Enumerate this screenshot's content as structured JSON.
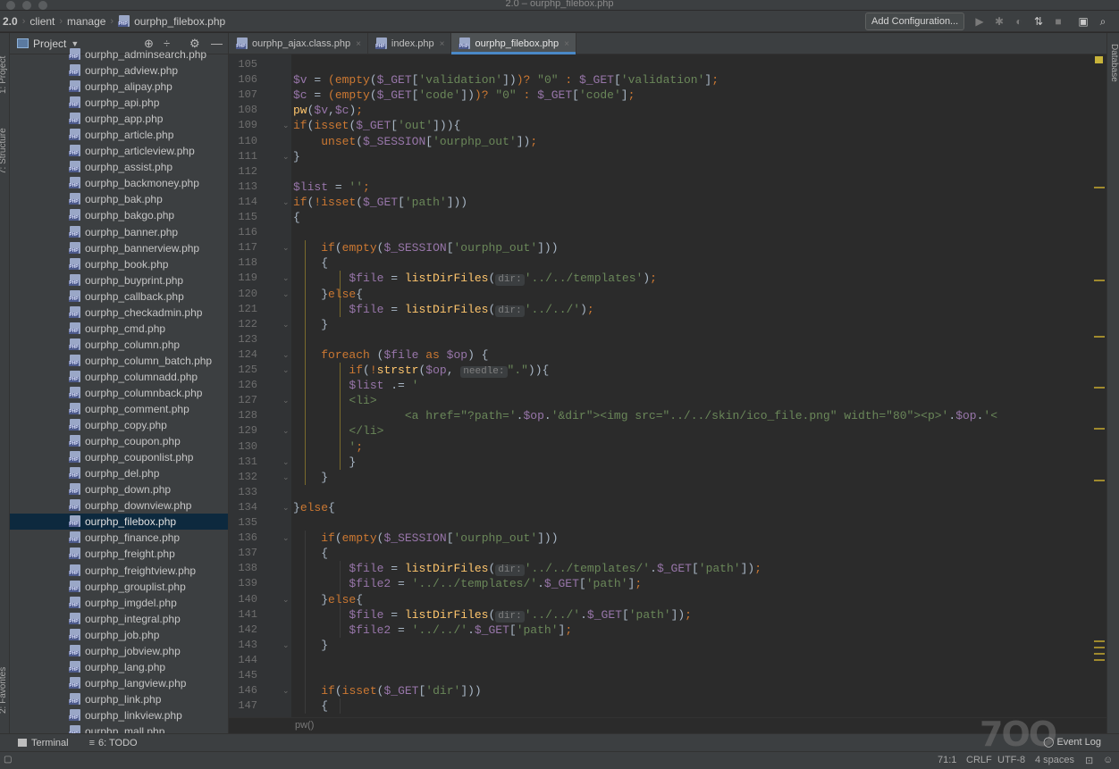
{
  "window": {
    "title": "2.0 – ourphp_filebox.php"
  },
  "breadcrumbs": [
    "2.0",
    "client",
    "manage",
    "ourphp_filebox.php"
  ],
  "toolbar": {
    "add_configuration": "Add Configuration..."
  },
  "left_tool_labels": [
    "1: Project",
    "7: Structure",
    "2: Favorites"
  ],
  "right_tool_labels": [
    "Database"
  ],
  "project": {
    "title": "Project",
    "files": [
      "ourphp_adminsearch.php",
      "ourphp_adview.php",
      "ourphp_alipay.php",
      "ourphp_api.php",
      "ourphp_app.php",
      "ourphp_article.php",
      "ourphp_articleview.php",
      "ourphp_assist.php",
      "ourphp_backmoney.php",
      "ourphp_bak.php",
      "ourphp_bakgo.php",
      "ourphp_banner.php",
      "ourphp_bannerview.php",
      "ourphp_book.php",
      "ourphp_buyprint.php",
      "ourphp_callback.php",
      "ourphp_checkadmin.php",
      "ourphp_cmd.php",
      "ourphp_column.php",
      "ourphp_column_batch.php",
      "ourphp_columnadd.php",
      "ourphp_columnback.php",
      "ourphp_comment.php",
      "ourphp_copy.php",
      "ourphp_coupon.php",
      "ourphp_couponlist.php",
      "ourphp_del.php",
      "ourphp_down.php",
      "ourphp_downview.php",
      "ourphp_filebox.php",
      "ourphp_finance.php",
      "ourphp_freight.php",
      "ourphp_freightview.php",
      "ourphp_grouplist.php",
      "ourphp_imgdel.php",
      "ourphp_integral.php",
      "ourphp_job.php",
      "ourphp_jobview.php",
      "ourphp_lang.php",
      "ourphp_langview.php",
      "ourphp_link.php",
      "ourphp_linkview.php",
      "ourphp_mall.php"
    ],
    "selected_file": "ourphp_filebox.php"
  },
  "tabs": [
    {
      "label": "ourphp_ajax.class.php",
      "active": false
    },
    {
      "label": "index.php",
      "active": false
    },
    {
      "label": "ourphp_filebox.php",
      "active": true
    }
  ],
  "editor": {
    "first_line": 105,
    "breadcrumb_hint": "pw()",
    "lines": [
      [],
      [
        [
          "var",
          "$v"
        ],
        [
          "plain",
          " = "
        ],
        [
          "kw",
          "("
        ],
        [
          "kw",
          "empty"
        ],
        [
          "plain",
          "("
        ],
        [
          "var",
          "$_GET"
        ],
        [
          "plain",
          "["
        ],
        [
          "str",
          "'validation'"
        ],
        [
          "plain",
          "])"
        ],
        [
          "kw",
          ")"
        ],
        [
          "kw",
          "? "
        ],
        [
          "str",
          "\"0\""
        ],
        [
          "kw",
          " : "
        ],
        [
          "var",
          "$_GET"
        ],
        [
          "plain",
          "["
        ],
        [
          "str",
          "'validation'"
        ],
        [
          "plain",
          "]"
        ],
        [
          "kw",
          ";"
        ]
      ],
      [
        [
          "var",
          "$c"
        ],
        [
          "plain",
          " = "
        ],
        [
          "kw",
          "("
        ],
        [
          "kw",
          "empty"
        ],
        [
          "plain",
          "("
        ],
        [
          "var",
          "$_GET"
        ],
        [
          "plain",
          "["
        ],
        [
          "str",
          "'code'"
        ],
        [
          "plain",
          "])"
        ],
        [
          "kw",
          ")"
        ],
        [
          "kw",
          "? "
        ],
        [
          "str",
          "\"0\""
        ],
        [
          "kw",
          " : "
        ],
        [
          "var",
          "$_GET"
        ],
        [
          "plain",
          "["
        ],
        [
          "str",
          "'code'"
        ],
        [
          "plain",
          "]"
        ],
        [
          "kw",
          ";"
        ]
      ],
      [
        [
          "fn",
          "pw"
        ],
        [
          "plain",
          "("
        ],
        [
          "var",
          "$v"
        ],
        [
          "plain",
          ","
        ],
        [
          "var",
          "$c"
        ],
        [
          "plain",
          ")"
        ],
        [
          "kw",
          ";"
        ]
      ],
      [
        [
          "kw",
          "if"
        ],
        [
          "plain",
          "("
        ],
        [
          "kw",
          "isset"
        ],
        [
          "plain",
          "("
        ],
        [
          "var",
          "$_GET"
        ],
        [
          "plain",
          "["
        ],
        [
          "str",
          "'out'"
        ],
        [
          "plain",
          "])){"
        ]
      ],
      [
        [
          "plain",
          "    "
        ],
        [
          "kw",
          "unset"
        ],
        [
          "plain",
          "("
        ],
        [
          "var",
          "$_SESSION"
        ],
        [
          "plain",
          "["
        ],
        [
          "str",
          "'ourphp_out'"
        ],
        [
          "plain",
          "])"
        ],
        [
          "kw",
          ";"
        ]
      ],
      [
        [
          "plain",
          "}"
        ]
      ],
      [],
      [
        [
          "var",
          "$list"
        ],
        [
          "plain",
          " = "
        ],
        [
          "str",
          "''"
        ],
        [
          "kw",
          ";"
        ]
      ],
      [
        [
          "kw",
          "if"
        ],
        [
          "plain",
          "("
        ],
        [
          "kw",
          "!isset"
        ],
        [
          "plain",
          "("
        ],
        [
          "var",
          "$_GET"
        ],
        [
          "plain",
          "["
        ],
        [
          "str",
          "'path'"
        ],
        [
          "plain",
          "]))"
        ]
      ],
      [
        [
          "plain",
          "{"
        ]
      ],
      [],
      [
        [
          "plain",
          "    "
        ],
        [
          "kw",
          "if"
        ],
        [
          "plain",
          "("
        ],
        [
          "kw",
          "empty"
        ],
        [
          "plain",
          "("
        ],
        [
          "var",
          "$_SESSION"
        ],
        [
          "plain",
          "["
        ],
        [
          "str",
          "'ourphp_out'"
        ],
        [
          "plain",
          "]))"
        ]
      ],
      [
        [
          "plain",
          "    {"
        ]
      ],
      [
        [
          "plain",
          "        "
        ],
        [
          "var",
          "$file"
        ],
        [
          "plain",
          " = "
        ],
        [
          "fn",
          "listDirFiles"
        ],
        [
          "plain",
          "("
        ],
        [
          "hint",
          "dir:"
        ],
        [
          "str",
          "'../../templates'"
        ],
        [
          "plain",
          ")"
        ],
        [
          "kw",
          ";"
        ]
      ],
      [
        [
          "plain",
          "    }"
        ],
        [
          "kw",
          "else"
        ],
        [
          "plain",
          "{"
        ]
      ],
      [
        [
          "plain",
          "        "
        ],
        [
          "var",
          "$file"
        ],
        [
          "plain",
          " = "
        ],
        [
          "fn",
          "listDirFiles"
        ],
        [
          "plain",
          "("
        ],
        [
          "hint",
          "dir:"
        ],
        [
          "str",
          "'../../'"
        ],
        [
          "plain",
          ")"
        ],
        [
          "kw",
          ";"
        ]
      ],
      [
        [
          "plain",
          "    }"
        ]
      ],
      [],
      [
        [
          "plain",
          "    "
        ],
        [
          "kw",
          "foreach"
        ],
        [
          "plain",
          " ("
        ],
        [
          "var",
          "$file"
        ],
        [
          "kw",
          " as "
        ],
        [
          "var",
          "$op"
        ],
        [
          "plain",
          ") {"
        ]
      ],
      [
        [
          "plain",
          "        "
        ],
        [
          "kw",
          "if"
        ],
        [
          "plain",
          "("
        ],
        [
          "kw",
          "!"
        ],
        [
          "fn",
          "strstr"
        ],
        [
          "plain",
          "("
        ],
        [
          "var",
          "$op"
        ],
        [
          "plain",
          ", "
        ],
        [
          "hint",
          "needle:"
        ],
        [
          "str",
          "\".\""
        ],
        [
          "plain",
          "))"
        ],
        [
          "plain",
          "{"
        ]
      ],
      [
        [
          "plain",
          "        "
        ],
        [
          "var",
          "$list"
        ],
        [
          "plain",
          " .= "
        ],
        [
          "str",
          "'"
        ]
      ],
      [
        [
          "plain",
          "        "
        ],
        [
          "str",
          "<li>"
        ]
      ],
      [
        [
          "plain",
          "                "
        ],
        [
          "str",
          "<a href=\"?path='"
        ],
        [
          "plain",
          "."
        ],
        [
          "var",
          "$op"
        ],
        [
          "plain",
          "."
        ],
        [
          "str",
          "'&dir\"><img src=\"../../skin/ico_file.png\" width=\"80\"><p>'"
        ],
        [
          "plain",
          "."
        ],
        [
          "var",
          "$op"
        ],
        [
          "plain",
          "."
        ],
        [
          "str",
          "'<"
        ]
      ],
      [
        [
          "plain",
          "        "
        ],
        [
          "str",
          "</li>"
        ]
      ],
      [
        [
          "plain",
          "        "
        ],
        [
          "str",
          "'"
        ],
        [
          "kw",
          ";"
        ]
      ],
      [
        [
          "plain",
          "        }"
        ]
      ],
      [
        [
          "plain",
          "    }"
        ]
      ],
      [],
      [
        [
          "plain",
          "}"
        ],
        [
          "kw",
          "else"
        ],
        [
          "plain",
          "{"
        ]
      ],
      [],
      [
        [
          "plain",
          "    "
        ],
        [
          "kw",
          "if"
        ],
        [
          "plain",
          "("
        ],
        [
          "kw",
          "empty"
        ],
        [
          "plain",
          "("
        ],
        [
          "var",
          "$_SESSION"
        ],
        [
          "plain",
          "["
        ],
        [
          "str",
          "'ourphp_out'"
        ],
        [
          "plain",
          "]))"
        ]
      ],
      [
        [
          "plain",
          "    {"
        ]
      ],
      [
        [
          "plain",
          "        "
        ],
        [
          "var",
          "$file"
        ],
        [
          "plain",
          " = "
        ],
        [
          "fn",
          "listDirFiles"
        ],
        [
          "plain",
          "("
        ],
        [
          "hint",
          "dir:"
        ],
        [
          "str",
          "'../../templates/'"
        ],
        [
          "plain",
          "."
        ],
        [
          "var",
          "$_GET"
        ],
        [
          "plain",
          "["
        ],
        [
          "str",
          "'path'"
        ],
        [
          "plain",
          "])"
        ],
        [
          "kw",
          ";"
        ]
      ],
      [
        [
          "plain",
          "        "
        ],
        [
          "var",
          "$file2"
        ],
        [
          "plain",
          " = "
        ],
        [
          "str",
          "'../../templates/'"
        ],
        [
          "plain",
          "."
        ],
        [
          "var",
          "$_GET"
        ],
        [
          "plain",
          "["
        ],
        [
          "str",
          "'path'"
        ],
        [
          "plain",
          "]"
        ],
        [
          "kw",
          ";"
        ]
      ],
      [
        [
          "plain",
          "    }"
        ],
        [
          "kw",
          "else"
        ],
        [
          "plain",
          "{"
        ]
      ],
      [
        [
          "plain",
          "        "
        ],
        [
          "var",
          "$file"
        ],
        [
          "plain",
          " = "
        ],
        [
          "fn",
          "listDirFiles"
        ],
        [
          "plain",
          "("
        ],
        [
          "hint",
          "dir:"
        ],
        [
          "str",
          "'../../'"
        ],
        [
          "plain",
          "."
        ],
        [
          "var",
          "$_GET"
        ],
        [
          "plain",
          "["
        ],
        [
          "str",
          "'path'"
        ],
        [
          "plain",
          "])"
        ],
        [
          "kw",
          ";"
        ]
      ],
      [
        [
          "plain",
          "        "
        ],
        [
          "var",
          "$file2"
        ],
        [
          "plain",
          " = "
        ],
        [
          "str",
          "'../../'"
        ],
        [
          "plain",
          "."
        ],
        [
          "var",
          "$_GET"
        ],
        [
          "plain",
          "["
        ],
        [
          "str",
          "'path'"
        ],
        [
          "plain",
          "]"
        ],
        [
          "kw",
          ";"
        ]
      ],
      [
        [
          "plain",
          "    }"
        ]
      ],
      [],
      [],
      [
        [
          "plain",
          "    "
        ],
        [
          "kw",
          "if"
        ],
        [
          "plain",
          "("
        ],
        [
          "kw",
          "isset"
        ],
        [
          "plain",
          "("
        ],
        [
          "var",
          "$_GET"
        ],
        [
          "plain",
          "["
        ],
        [
          "str",
          "'dir'"
        ],
        [
          "plain",
          "]))"
        ]
      ],
      [
        [
          "plain",
          "    {"
        ]
      ]
    ]
  },
  "bottom_tools": [
    {
      "label": "Terminal"
    },
    {
      "label": "6: TODO"
    }
  ],
  "event_log": "Event Log",
  "status": {
    "position": "71:1",
    "line_sep": "CRLF",
    "encoding": "UTF-8",
    "indent": "4 spaces"
  },
  "watermark": "7OO"
}
